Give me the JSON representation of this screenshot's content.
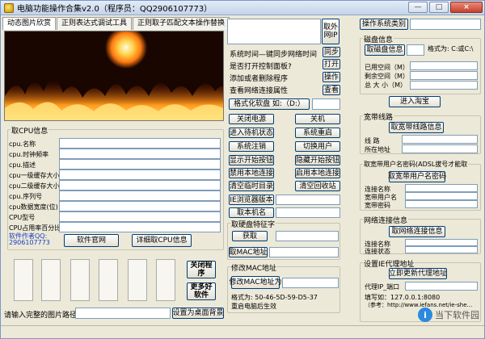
{
  "window": {
    "title": "电脑功能操作合集v2.0（程序员：QQ2906107773）",
    "buttons": [
      "—",
      "□",
      "×"
    ]
  },
  "tabs": [
    {
      "label": "动态图片欣赏",
      "active": true
    },
    {
      "label": "正则表达式调试工具",
      "active": false
    },
    {
      "label": "正则取子匹配文本操作替换",
      "active": false
    }
  ],
  "network": {
    "fetch_ip_label": "取外网IP",
    "sync_label": "同步",
    "open_label": "打开",
    "operate_label": "操作",
    "view_label": "查看",
    "text_lines": [
      "系统时间—键同步网络时间",
      "是否打开控制面板?",
      "添加或者删除程序",
      "查看网络连接属性"
    ],
    "format_label": "格式化软盘 如:（D:）"
  },
  "actions": {
    "buttons": [
      "关闭电源",
      "关机",
      "进入待机状态",
      "系统重启",
      "系统注销",
      "切换用户",
      "显示开始按钮",
      "隐藏开始按钮",
      "禁用本地连接",
      "启用本地连接",
      "清空临时目录",
      "清空回收站",
      "IE浏览器版本",
      "取本机名"
    ]
  },
  "cpu": {
    "group_title": "取CPU信息",
    "fields": [
      "cpu.名称",
      "cpu.时钟频率",
      "cpu.描述",
      "cpu一级缓存大小",
      "cpu二级缓存大小",
      "cpu.序列号",
      "cpu数据宽度(位)",
      "CPU型号",
      "CPU占用率百分比"
    ],
    "author_label": "软件作者QQ:",
    "author_qq": "2906107773",
    "official_label": "软件官网",
    "detail_label": "详细取CPU信息"
  },
  "disk": {
    "group_title": "取硬盘特征字",
    "get_label": "获取",
    "mac_label": "取MAC地址"
  },
  "mac": {
    "group_title": "修改MAC地址",
    "modify_label": "修改MAC地址为",
    "format_line": "格式为: 50-46-5D-59-D5-37",
    "restart_line": "重启电脑后生效"
  },
  "side_buttons": {
    "close_app": "关闭程序",
    "more_software": "更多好软件"
  },
  "bottom": {
    "path_label": "请输入完整的图片路径",
    "set_desktop": "设置为桌面背景"
  },
  "right": {
    "os_button": "操作系统类别",
    "disk_group": "磁盘信息",
    "disk_info_button": "取磁盘信息",
    "disk_format": "格式为: C:或C:\\",
    "used": "已用空间（M）",
    "free": "剩余空间（M）",
    "total": "总 大 小（M）",
    "taobao": "进入淘宝",
    "broadband_group": "宽带线路",
    "broadband_button": "取宽带线路信息",
    "line": "线  路",
    "location": "所在地址",
    "account_group": "取宽带用户名密码(ADSL拔号才能取",
    "account_button": "取宽带用户名密码",
    "conn_name": "连接名称",
    "bb_user": "宽带用户名",
    "bb_pass": "宽带密码",
    "net_group": "网络连接信息",
    "net_button": "取网络连接信息",
    "conn_name2": "连接名称",
    "conn_status": "连接状态",
    "proxy_group": "设置IE代理地址",
    "proxy_button": "立即更新代理地址",
    "proxy_ip": "代理IP_端口",
    "proxy_example": "填写如：127.0.0.1:8080",
    "proxy_ref": "（参考：http://www.iefans.net/ie-she..."
  },
  "watermark": {
    "logo": "i",
    "text": "当下软件园"
  },
  "colors": {
    "accent": "#1a3cc0",
    "frame": "#ece9d8",
    "titlebar": "#c3d3ea"
  }
}
